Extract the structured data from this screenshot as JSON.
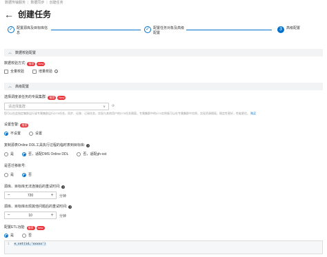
{
  "breadcrumb": [
    "数据传输服务",
    "数据同步",
    "创建任务"
  ],
  "header": {
    "back_icon": "←",
    "title": "创建任务"
  },
  "steps": [
    {
      "num": "✓",
      "label": "配置源库及目标库信息",
      "state": "done"
    },
    {
      "num": "✓",
      "label": "配置任务对象及高级配置",
      "state": "done"
    },
    {
      "num": "3",
      "label": "高级配置",
      "state": "current"
    }
  ],
  "sections": {
    "data_check": "数据校验配置",
    "advanced": "高级配置"
  },
  "check_mode": {
    "label": "数据校验方式:",
    "tag_recommend": "推荐",
    "tag_new": "New",
    "options": [
      "全量校验",
      "增量校验"
    ]
  },
  "cluster": {
    "label": "选择调度该任务的专属集群:",
    "tag_recommend": "推荐",
    "tag_new": "New",
    "placeholder": "请选择集群",
    "desc": "您可以在此指定集群运行该专属集群运行DTS任务，同步、迁移、订阅任务，实现与其他用户的DTS任务隔离，专属集群中的DTS实例既可以在专属集群中实例，实现资源隔离，稳定性更好，性能更优。",
    "link": "购买"
  },
  "alert": {
    "label": "设置告警:",
    "tag_recommend": "推荐",
    "options": [
      "不设置",
      "设置"
    ]
  },
  "ddl": {
    "label": "复制源表Online DDL工具执行过程的临时表到目标库:",
    "options": [
      "是",
      "否，适配DMS Online DDL",
      "否，适配gh-ost"
    ]
  },
  "migrate_account": {
    "label": "是否迁移账号:",
    "options": [
      "是",
      "否"
    ]
  },
  "retry_conn": {
    "label": "源库、目标库无法连接后的重试时间:",
    "value": "720",
    "unit": "分钟"
  },
  "retry_other": {
    "label": "源库、目标库出现其他问题后的重试时间:",
    "value": "10",
    "unit": "分钟"
  },
  "etl": {
    "label": "配置ETL功能:",
    "tag_recommend": "推荐",
    "tag_new": "New",
    "options": [
      "是",
      "否"
    ],
    "code_line_no": "1",
    "code": "e_set(id,'xxxxx')"
  },
  "colors": {
    "accent": "#0070cc",
    "tag": "#e8343a"
  }
}
